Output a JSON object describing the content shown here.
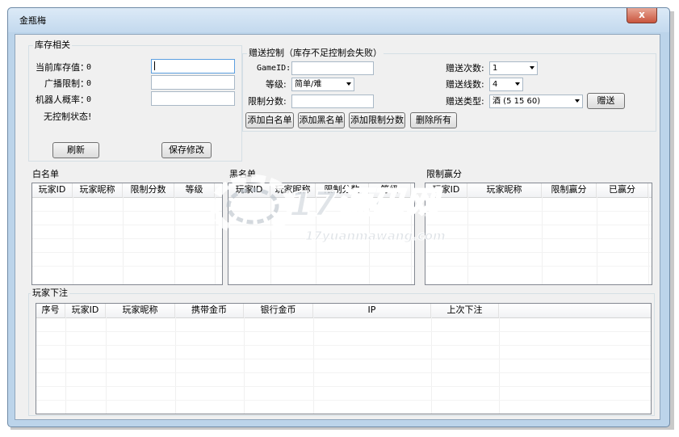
{
  "window": {
    "title": "金瓶梅",
    "close": "x"
  },
  "stock": {
    "group_title": "库存相关",
    "current_label": "当前库存值：",
    "current_value": "0",
    "broadcast_label": "广播限制：",
    "broadcast_value": "0",
    "robot_label": "机器人概率：",
    "robot_value": "0",
    "status_label": "无控制状态!",
    "refresh_btn": "刷新",
    "save_btn": "保存修改"
  },
  "gift": {
    "group_title": "赠送控制（库存不足控制会失败）",
    "gameid_label": "GameID:",
    "level_label": "等级:",
    "level_value": "简单/难",
    "limit_label": "限制分数:",
    "times_label": "赠送次数:",
    "times_value": "1",
    "lines_label": "赠送线数:",
    "lines_value": "4",
    "type_label": "赠送类型:",
    "type_value": "酒 (5 15 60)",
    "send_btn": "赠送",
    "add_white_btn": "添加白名单",
    "add_black_btn": "添加黑名单",
    "add_limit_btn": "添加限制分数",
    "delete_all_btn": "删除所有"
  },
  "whitelist": {
    "title": "白名单",
    "columns": [
      "玩家ID",
      "玩家昵称",
      "限制分数",
      "等级"
    ]
  },
  "blacklist": {
    "title": "黑名单",
    "columns": [
      "玩家ID",
      "玩家昵称",
      "限制分数",
      "等级"
    ]
  },
  "limitwin": {
    "title": "限制赢分",
    "columns": [
      "玩家ID",
      "玩家昵称",
      "限制赢分",
      "已赢分"
    ]
  },
  "bets": {
    "title": "玩家下注",
    "columns": [
      "序号",
      "玩家ID",
      "玩家昵称",
      "携带金币",
      "银行金币",
      "IP",
      "上次下注"
    ]
  },
  "watermark": {
    "main": "17源码网",
    "sub": "17yuanmawang.com"
  },
  "colors": {
    "window_frame": "#bcd4ea",
    "client_bg": "#f0f0f0",
    "close_button": "#c9553e"
  }
}
